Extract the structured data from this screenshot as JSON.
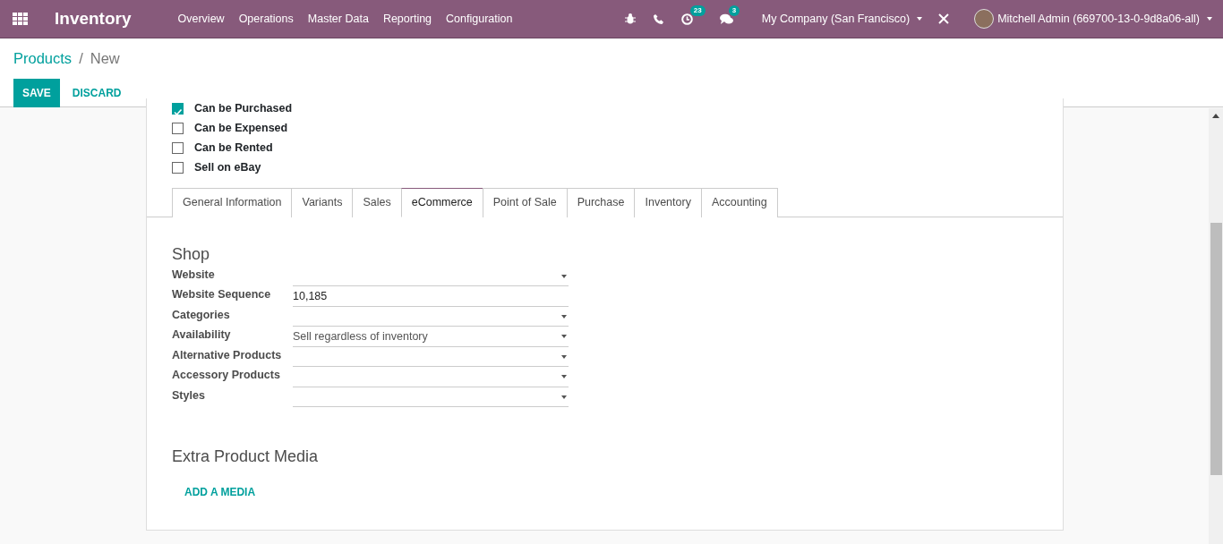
{
  "navbar": {
    "app_title": "Inventory",
    "menu": [
      "Overview",
      "Operations",
      "Master Data",
      "Reporting",
      "Configuration"
    ],
    "activity_count": "23",
    "message_count": "3",
    "company": "My Company (San Francisco)",
    "user": "Mitchell Admin (669700-13-0-9d8a06-all)"
  },
  "breadcrumb": {
    "parent": "Products",
    "separator": "/",
    "current": "New"
  },
  "buttons": {
    "save": "SAVE",
    "discard": "DISCARD"
  },
  "checkboxes": [
    {
      "label": "Can be Purchased",
      "checked": true
    },
    {
      "label": "Can be Expensed",
      "checked": false
    },
    {
      "label": "Can be Rented",
      "checked": false
    },
    {
      "label": "Sell on eBay",
      "checked": false
    }
  ],
  "tabs": [
    {
      "label": "General Information",
      "selected": false
    },
    {
      "label": "Variants",
      "selected": false
    },
    {
      "label": "Sales",
      "selected": false
    },
    {
      "label": "eCommerce",
      "selected": true
    },
    {
      "label": "Point of Sale",
      "selected": false
    },
    {
      "label": "Purchase",
      "selected": false
    },
    {
      "label": "Inventory",
      "selected": false
    },
    {
      "label": "Accounting",
      "selected": false
    }
  ],
  "shop": {
    "title": "Shop",
    "fields": [
      {
        "label": "Website",
        "kind": "select"
      },
      {
        "label": "Website Sequence",
        "kind": "text",
        "value": "10,185"
      },
      {
        "label": "Categories",
        "kind": "select"
      },
      {
        "label": "Availability",
        "kind": "select",
        "value": "Sell regardless of inventory"
      },
      {
        "label": "Alternative Products",
        "kind": "select"
      },
      {
        "label": "Accessory Products",
        "kind": "select"
      },
      {
        "label": "Styles",
        "kind": "select"
      }
    ]
  },
  "media": {
    "title": "Extra Product Media",
    "add_button": "ADD A MEDIA"
  }
}
